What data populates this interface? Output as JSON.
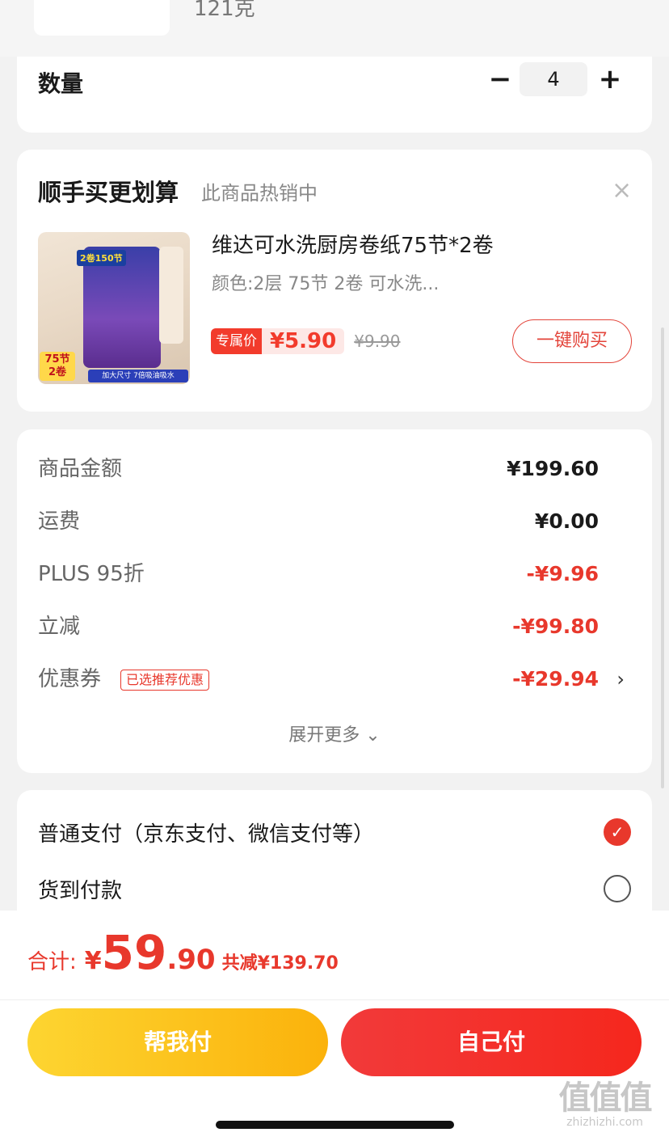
{
  "top_item": {
    "weight": "121克"
  },
  "quantity": {
    "label": "数量",
    "minus": "−",
    "value": "4",
    "plus": "+"
  },
  "upsell": {
    "title": "顺手买更划算",
    "subtitle": "此商品热销中",
    "close_icon": "×",
    "product": {
      "image": {
        "badge": "2卷150节",
        "count_badge_line1": "75节",
        "count_badge_line2": "2卷",
        "strip": "加大尺寸 7倍吸油吸水"
      },
      "name": "维达可水洗厨房卷纸75节*2卷",
      "spec": "颜色:2层 75节 2卷 可水洗...",
      "price_tag": "专属价",
      "price": "¥5.90",
      "old_price": "¥9.90",
      "buy_label": "一键购买"
    }
  },
  "summary": {
    "rows": [
      {
        "label": "商品金额",
        "value": "¥199.60"
      },
      {
        "label": "运费",
        "value": "¥0.00"
      },
      {
        "label": "PLUS 95折",
        "value": "-¥9.96"
      },
      {
        "label": "立减",
        "value": "-¥99.80"
      },
      {
        "label": "优惠券",
        "tag": "已选推荐优惠",
        "value": "-¥29.94",
        "chevron": "›"
      }
    ],
    "expand_label": "展开更多 ⌄"
  },
  "payment": {
    "options": [
      {
        "label": "普通支付（京东支付、微信支付等）",
        "selected": true,
        "check": "✓"
      },
      {
        "label": "货到付款",
        "selected": false
      }
    ]
  },
  "bottom": {
    "total_label": "合计:",
    "currency": "¥",
    "total_int": "59",
    "total_dec": ".90",
    "saved": "共减¥139.70",
    "help_pay": "帮我付",
    "self_pay": "自己付"
  },
  "watermark": {
    "top": "值值值",
    "bottom": "zhizhizhi.com"
  },
  "colors": {
    "accent_red": "#e8382c",
    "help_yellow": "#fbb20b",
    "self_red": "#f23a3a"
  }
}
